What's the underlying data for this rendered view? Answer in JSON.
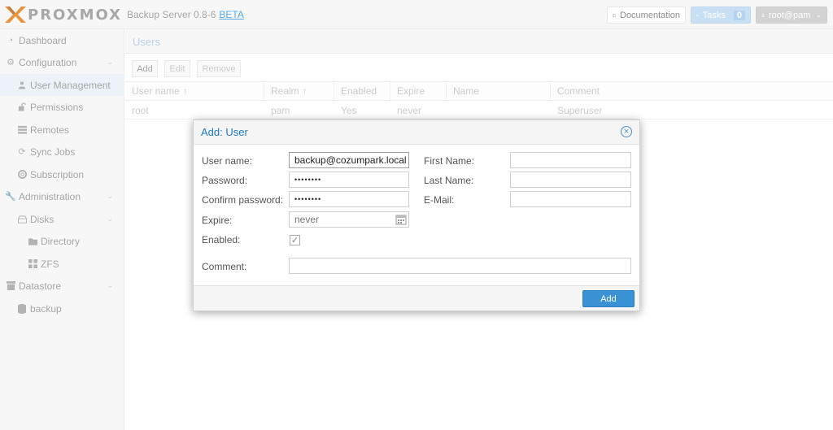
{
  "header": {
    "logo_text": "PROXMOX",
    "product": "Backup Server 0.8-6",
    "beta": "BETA",
    "documentation": "Documentation",
    "tasks": "Tasks",
    "tasks_count": "0",
    "user": "root@pam"
  },
  "sidebar": {
    "items": [
      {
        "label": "Dashboard",
        "icon": "dashboard-icon"
      },
      {
        "label": "Configuration",
        "icon": "gears-icon"
      },
      {
        "label": "User Management",
        "icon": "user-icon"
      },
      {
        "label": "Permissions",
        "icon": "unlock-icon"
      },
      {
        "label": "Remotes",
        "icon": "server-icon"
      },
      {
        "label": "Sync Jobs",
        "icon": "refresh-icon"
      },
      {
        "label": "Subscription",
        "icon": "support-icon"
      },
      {
        "label": "Administration",
        "icon": "wrench-icon"
      },
      {
        "label": "Disks",
        "icon": "hdd-icon"
      },
      {
        "label": "Directory",
        "icon": "folder-icon"
      },
      {
        "label": "ZFS",
        "icon": "th-large-icon"
      },
      {
        "label": "Datastore",
        "icon": "archive-icon"
      },
      {
        "label": "backup",
        "icon": "database-icon"
      }
    ]
  },
  "main": {
    "title": "Users",
    "toolbar": {
      "add": "Add",
      "edit": "Edit",
      "remove": "Remove"
    },
    "columns": [
      "User name",
      "Realm",
      "Enabled",
      "Expire",
      "Name",
      "Comment"
    ],
    "rows": [
      {
        "user": "root",
        "realm": "pam",
        "enabled": "Yes",
        "expire": "never",
        "name": "",
        "comment": "Superuser"
      }
    ]
  },
  "dialog": {
    "title": "Add: User",
    "labels": {
      "username": "User name:",
      "password": "Password:",
      "confirm": "Confirm password:",
      "expire": "Expire:",
      "enabled": "Enabled:",
      "comment": "Comment:",
      "firstname": "First Name:",
      "lastname": "Last Name:",
      "email": "E-Mail:"
    },
    "values": {
      "username": "backup@cozumpark.local",
      "password": "••••••••",
      "confirm": "••••••••",
      "expire": "never",
      "enabled": true,
      "comment": "",
      "firstname": "",
      "lastname": "",
      "email": ""
    },
    "add_button": "Add"
  }
}
